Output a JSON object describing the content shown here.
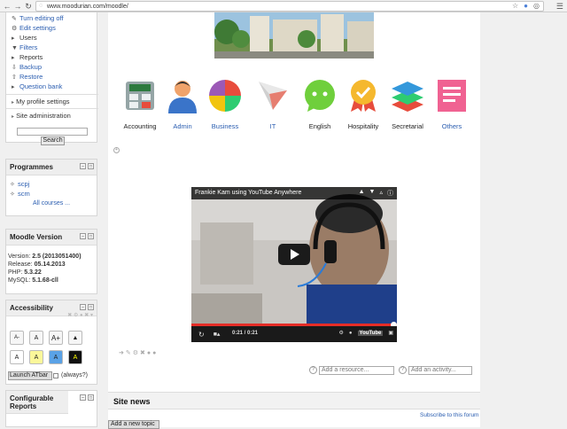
{
  "browser": {
    "url": "www.moodurian.com/moodle/"
  },
  "admin_block": {
    "items": [
      {
        "label": "Turn editing off",
        "icon": "pencil-icon"
      },
      {
        "label": "Edit settings",
        "icon": "gear-icon"
      },
      {
        "label": "Users",
        "icon": "arrow-right-icon"
      },
      {
        "label": "Filters",
        "icon": "filter-icon"
      },
      {
        "label": "Reports",
        "icon": "arrow-right-icon"
      },
      {
        "label": "Backup",
        "icon": "backup-icon"
      },
      {
        "label": "Restore",
        "icon": "restore-icon"
      },
      {
        "label": "Question bank",
        "icon": "arrow-right-icon"
      }
    ],
    "profile_settings": "My profile settings",
    "site_administration": "Site administration",
    "search_button": "Search"
  },
  "programmes": {
    "title": "Programmes",
    "items": [
      "scpj",
      "scm"
    ],
    "all_courses": "All courses ..."
  },
  "moodle_version": {
    "title": "Moodle Version",
    "lines": [
      {
        "label": "Version:",
        "value": "2.5 (2013051400)"
      },
      {
        "label": "Release:",
        "value": "05.14.2013"
      },
      {
        "label": "PHP:",
        "value": "5.3.22"
      },
      {
        "label": "MySQL:",
        "value": "5.1.68-cll"
      }
    ]
  },
  "accessibility": {
    "title": "Accessibility",
    "font_buttons": [
      "A-",
      "A",
      "A+"
    ],
    "color_buttons": [
      "A",
      "A",
      "A",
      "A"
    ],
    "launch_button": "Launch ATbar",
    "always_label": "(always?)"
  },
  "configurable_reports": {
    "title": "Configurable Reports"
  },
  "categories": [
    {
      "label": "Accounting",
      "icon": "calculator-icon",
      "link": false
    },
    {
      "label": "Admin",
      "icon": "person-icon",
      "link": true
    },
    {
      "label": "Business",
      "icon": "pie-chart-icon",
      "link": true
    },
    {
      "label": "IT",
      "icon": "paper-plane-icon",
      "link": true
    },
    {
      "label": "English",
      "icon": "chat-bubble-icon",
      "link": false
    },
    {
      "label": "Hospitality",
      "icon": "award-ribbon-icon",
      "link": false
    },
    {
      "label": "Secretarial",
      "icon": "layers-icon",
      "link": false
    },
    {
      "label": "Others",
      "icon": "document-icon",
      "link": true
    }
  ],
  "video": {
    "title": "Frankie Kam using YouTube Anywhere",
    "current_time": "0:21",
    "total_time": "0:21",
    "time_display": "0:21 / 0:21",
    "progress": 1.0
  },
  "resource_select": {
    "placeholder": "Add a resource..."
  },
  "activity_select": {
    "placeholder": "Add an activity..."
  },
  "news": {
    "title": "Site news",
    "subscribe": "Subscribe to this forum",
    "add_topic": "Add a new topic"
  }
}
